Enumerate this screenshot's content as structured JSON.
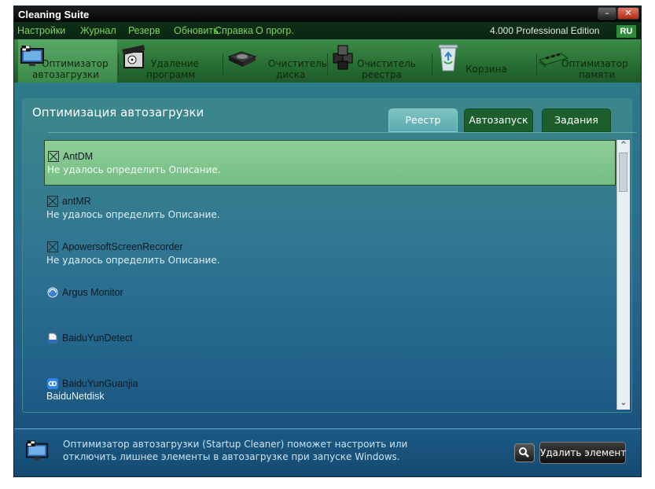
{
  "window": {
    "title": "Cleaning Suite"
  },
  "menu": {
    "items": [
      "Настройки",
      "Журнал",
      "Резерв",
      "Обновить",
      "Справка",
      "О прогр."
    ],
    "edition": "4.000 Professional Edition",
    "lang": "RU"
  },
  "tabs": [
    {
      "line1": "Оптимизатор",
      "line2": "автозагрузки",
      "icon": "monitor-icon"
    },
    {
      "line1": "Удаление",
      "line2": "программ",
      "icon": "film-box-icon"
    },
    {
      "line1": "Очиститель",
      "line2": "диска",
      "icon": "hard-drive-icon"
    },
    {
      "line1": "Очиститель",
      "line2": "реестра",
      "icon": "registry-cubes-icon"
    },
    {
      "line1": "Корзина",
      "line2": "",
      "icon": "recycle-bin-icon"
    },
    {
      "line1": "Оптимизатор",
      "line2": "памяти",
      "icon": "memory-chip-icon"
    }
  ],
  "panel": {
    "title": "Оптимизация автозагрузки",
    "subtabs": [
      "Реестр",
      "Автозапуск",
      "Задания"
    ]
  },
  "list": {
    "items": [
      {
        "name": "AntDM",
        "desc": "Не удалось определить Описание.",
        "icon": "unchecked-box-icon"
      },
      {
        "name": "antMR",
        "desc": "Не удалось определить Описание.",
        "icon": "unchecked-box-icon"
      },
      {
        "name": "ApowersoftScreenRecorder",
        "desc": "Не удалось определить Описание.",
        "icon": "unchecked-box-icon"
      },
      {
        "name": "Argus Monitor",
        "desc": "",
        "icon": "argus-globe-icon"
      },
      {
        "name": "BaiduYunDetect",
        "desc": "",
        "icon": "document-icon"
      },
      {
        "name": "BaiduYunGuanjia",
        "desc": "",
        "icon": "baidu-cloud-icon"
      },
      {
        "name": "BaiduNetdisk",
        "desc": "",
        "icon": ""
      }
    ]
  },
  "footer": {
    "line1": "Оптимизатор автозагрузки (Startup Cleaner) поможет настроить или",
    "line2": "отключить лишнее элементы в автозагрузке при запуске Windows.",
    "delete_label": "Удалить элемент"
  }
}
